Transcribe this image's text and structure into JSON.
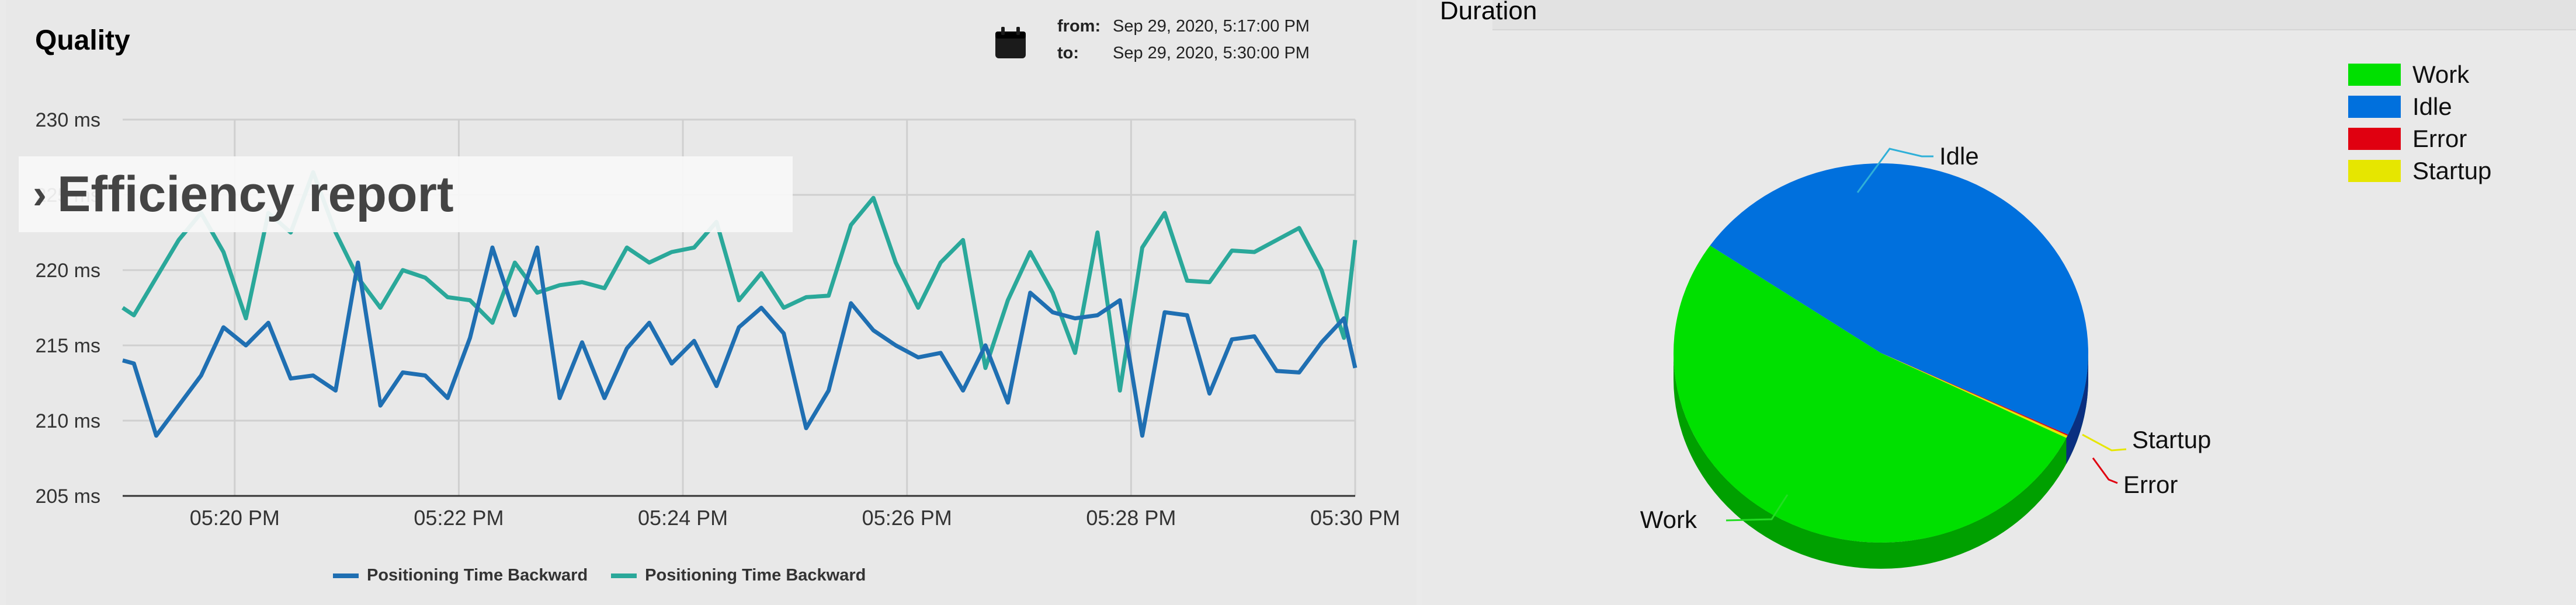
{
  "left_panel": {
    "title": "Quality",
    "icon": "calendar-icon",
    "date_range": {
      "from_label": "from:",
      "from_value": "Sep 29, 2020, 5:17:00 PM",
      "to_label": "to:",
      "to_value": "Sep 29, 2020, 5:30:00 PM"
    },
    "banner": {
      "icon": "chevron-right-icon",
      "label": "Efficiency report"
    }
  },
  "right_panel": {
    "title": "Duration"
  },
  "colors": {
    "series_dark": "#1f6fb2",
    "series_teal": "#2aa89a",
    "work": "#00e000",
    "idle": "#0070dd",
    "error": "#e00010",
    "startup": "#e6e600"
  },
  "chart_data": [
    {
      "type": "line",
      "title": "Quality",
      "xlabel": "",
      "ylabel": "",
      "x_ticks": [
        "05:20 PM",
        "05:22 PM",
        "05:24 PM",
        "05:26 PM",
        "05:28 PM",
        "05:30 PM"
      ],
      "x_tick_values": [
        20,
        22,
        24,
        26,
        28,
        30
      ],
      "xlim": [
        19.0,
        30.0
      ],
      "y_ticks": [
        "205 ms",
        "210 ms",
        "215 ms",
        "220 ms",
        "225 ms",
        "230 ms"
      ],
      "y_tick_values": [
        205,
        210,
        215,
        220,
        225,
        230
      ],
      "ylim": [
        205,
        230
      ],
      "grid": true,
      "legend_position": "bottom",
      "series": [
        {
          "name": "Positioning Time Backward",
          "color": "#1f6fb2",
          "x": [
            19.0,
            19.1,
            19.3,
            19.5,
            19.7,
            19.9,
            20.1,
            20.3,
            20.5,
            20.7,
            20.9,
            21.1,
            21.3,
            21.5,
            21.7,
            21.9,
            22.1,
            22.3,
            22.5,
            22.7,
            22.9,
            23.1,
            23.3,
            23.5,
            23.7,
            23.9,
            24.1,
            24.3,
            24.5,
            24.7,
            24.9,
            25.1,
            25.3,
            25.5,
            25.7,
            25.9,
            26.1,
            26.3,
            26.5,
            26.7,
            26.9,
            27.1,
            27.3,
            27.5,
            27.7,
            27.9,
            28.1,
            28.3,
            28.5,
            28.7,
            28.9,
            29.1,
            29.3,
            29.5,
            29.7,
            29.9,
            30.0
          ],
          "values": [
            214,
            213.8,
            209,
            211,
            213,
            216.2,
            215,
            216.5,
            212.8,
            213,
            212,
            220.5,
            211,
            213.2,
            213,
            211.5,
            215.5,
            221.5,
            217,
            221.5,
            211.5,
            215.2,
            211.5,
            214.8,
            216.5,
            213.8,
            215.3,
            212.3,
            216.2,
            217.5,
            215.8,
            209.5,
            212,
            217.8,
            216,
            215,
            214.2,
            214.5,
            212,
            215,
            211.2,
            218.5,
            217.2,
            216.8,
            217,
            218,
            209,
            217.2,
            217,
            211.8,
            215.4,
            215.6,
            213.3,
            213.2,
            215.2,
            216.8,
            213.5
          ]
        },
        {
          "name": "Positioning Time Backward",
          "color": "#2aa89a",
          "x": [
            19.0,
            19.1,
            19.3,
            19.5,
            19.7,
            19.9,
            20.1,
            20.3,
            20.5,
            20.7,
            20.9,
            21.1,
            21.3,
            21.5,
            21.7,
            21.9,
            22.1,
            22.3,
            22.5,
            22.7,
            22.9,
            23.1,
            23.3,
            23.5,
            23.7,
            23.9,
            24.1,
            24.3,
            24.5,
            24.7,
            24.9,
            25.1,
            25.3,
            25.5,
            25.7,
            25.9,
            26.1,
            26.3,
            26.5,
            26.7,
            26.9,
            27.1,
            27.3,
            27.5,
            27.7,
            27.9,
            28.1,
            28.3,
            28.5,
            28.7,
            28.9,
            29.1,
            29.3,
            29.5,
            29.7,
            29.9,
            30.0
          ],
          "values": [
            217.5,
            217,
            219.5,
            222,
            223.8,
            221.2,
            216.8,
            223.8,
            222.5,
            226.5,
            222.5,
            219.5,
            217.5,
            220,
            219.5,
            218.2,
            218,
            216.5,
            220.5,
            218.5,
            219,
            219.2,
            218.8,
            221.5,
            220.5,
            221.2,
            221.5,
            223.2,
            218,
            219.8,
            217.5,
            218.2,
            218.3,
            223,
            224.8,
            220.5,
            217.5,
            220.5,
            222,
            213.5,
            218,
            221.2,
            218.5,
            214.5,
            222.5,
            212,
            221.5,
            223.8,
            219.3,
            219.2,
            221.3,
            221.2,
            222,
            222.8,
            220,
            215.5,
            222
          ]
        }
      ]
    },
    {
      "type": "pie",
      "title": "Duration",
      "legend_position": "top-right",
      "labels": [
        "Work",
        "Idle",
        "Error",
        "Startup"
      ],
      "values": [
        52.2,
        47.5,
        0.1,
        0.2
      ],
      "colors": [
        "#00e000",
        "#0070dd",
        "#e00010",
        "#e6e600"
      ]
    }
  ]
}
